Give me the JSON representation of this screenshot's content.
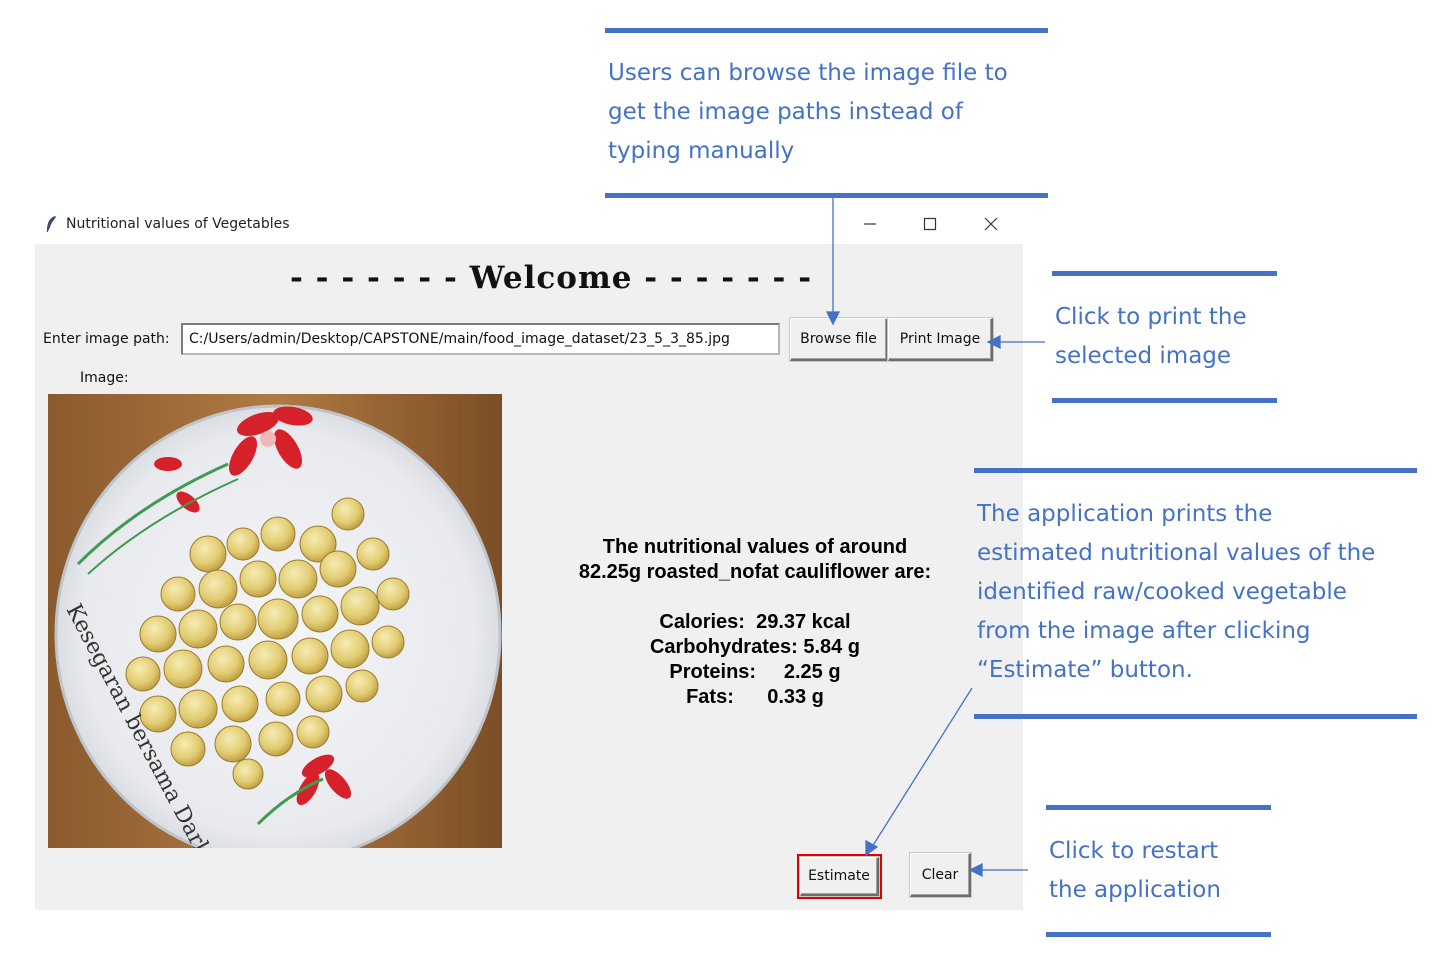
{
  "window": {
    "title": "Nutritional values of Vegetables",
    "icon": "feather-icon",
    "controls": {
      "minimize": "─",
      "maximize": "☐",
      "close": "✕"
    }
  },
  "app": {
    "welcome": "- - - - - - - Welcome - - - - - - -",
    "path_label": "Enter image path:",
    "path_value": "C:/Users/admin/Desktop/CAPSTONE/main/food_image_dataset/23_5_3_85.jpg",
    "browse_label": "Browse file",
    "print_label": "Print Image",
    "image_label": "Image:",
    "result": {
      "line1": "The nutritional values of around",
      "line2": "82.25g roasted_nofat cauliflower are:",
      "rows": [
        "Calories:  29.37 kcal",
        "Carbohydrates: 5.84 g",
        "Proteins:     2.25 g",
        "Fats:      0.33 g"
      ]
    },
    "estimate_label": "Estimate",
    "clear_label": "Clear",
    "plate_text": "Kesegaran bersama Darlie"
  },
  "annotations": {
    "browse": [
      "Users can browse the image file to",
      "get the image paths instead of",
      "typing manually"
    ],
    "print": [
      "Click to print the",
      "selected image"
    ],
    "estimate": [
      "The application prints the",
      "estimated nutritional values of the",
      "identified raw/cooked vegetable",
      "from the image after clicking",
      "“Estimate” button."
    ],
    "clear": [
      "Click to restart",
      "the application"
    ]
  },
  "colors": {
    "annotation": "#4472c4",
    "estimate_highlight": "#e00000",
    "window_bg": "#f0f0f0"
  }
}
